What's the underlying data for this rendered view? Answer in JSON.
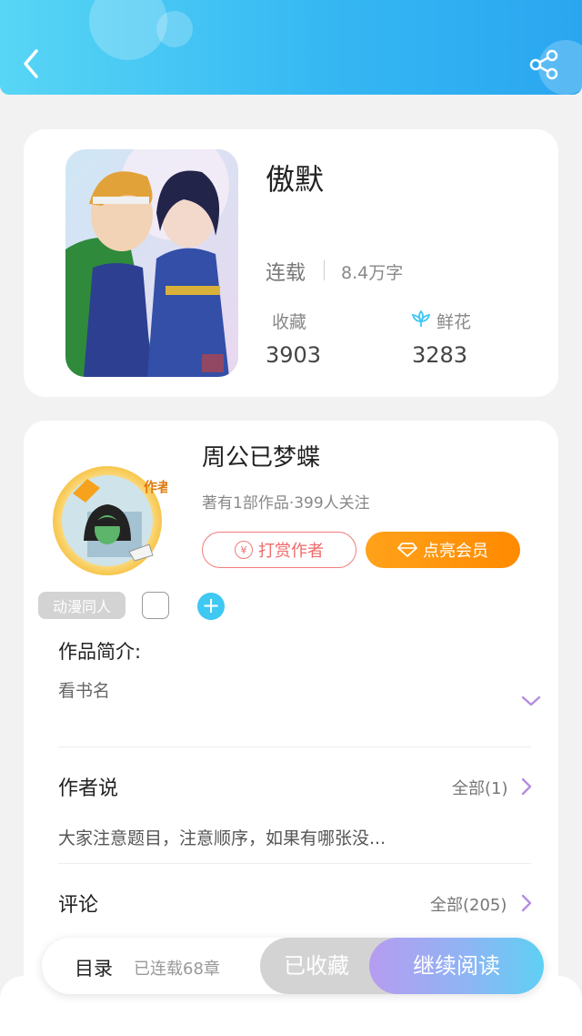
{
  "header": {
    "back_icon": "chevron-left-icon",
    "share_icon": "share-icon"
  },
  "book": {
    "title": "傲默",
    "status": "连载",
    "word_count": "8.4万字",
    "favorites_label": "收藏",
    "favorites_value": "3903",
    "flowers_label": "鲜花",
    "flowers_value": "3283"
  },
  "author": {
    "name": "周公已梦蝶",
    "meta": "著有1部作品·399人关注",
    "badge_text": "作者",
    "tip_label": "打赏作者",
    "tip_icon_text": "¥",
    "vip_label": "点亮会员"
  },
  "tags": {
    "first": "动漫同人",
    "add": "+"
  },
  "intro": {
    "title": "作品简介:",
    "text": "看书名"
  },
  "author_says": {
    "title": "作者说",
    "all": "全部(1)",
    "text": "大家注意题目，注意顺序，如果有哪张没..."
  },
  "comments": {
    "title": "评论",
    "all": "全部(205)"
  },
  "bottom": {
    "toc_label": "目录",
    "toc_count": "已连载68章",
    "collected_label": "已收藏",
    "read_label": "继续阅读"
  },
  "colors": {
    "header_start": "#58d6f5",
    "header_end": "#2aa6f0",
    "tip": "#f06a6a",
    "vip": "#ff8a00",
    "add": "#3ec8f2"
  }
}
